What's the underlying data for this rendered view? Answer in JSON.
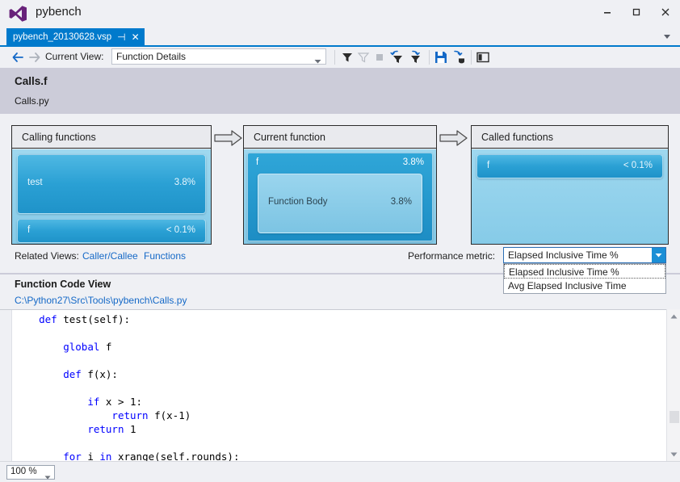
{
  "window": {
    "title": "pybench",
    "logo_icon": "visual-studio-logo",
    "minimize_label": "–",
    "maximize_label": "□",
    "close_label": "✕"
  },
  "tab": {
    "label": "pybench_20130628.vsp",
    "pin_icon": "pin-icon",
    "close_icon": "close-icon",
    "overflow_icon": "chevron-down-icon"
  },
  "toolbar": {
    "back_icon": "arrow-left-icon",
    "forward_icon": "arrow-right-icon",
    "current_view_label": "Current View:",
    "current_view_value": "Function Details",
    "icons": [
      "filter-icon",
      "clear-filter-icon",
      "stop-filter-icon",
      "undo-filter-icon",
      "redo-filter-icon",
      "save-icon",
      "export-report-icon",
      "split-view-icon"
    ]
  },
  "function_header": {
    "name": "Calls.f",
    "file": "Calls.py"
  },
  "panels": [
    {
      "id": "calling-functions",
      "title": "Calling functions",
      "bars": [
        {
          "label": "test",
          "value": "3.8%",
          "style": "strong"
        },
        {
          "label": "f",
          "value": "< 0.1%",
          "style": "strong"
        }
      ]
    },
    {
      "id": "current-function",
      "title": "Current function",
      "bars": [
        {
          "label": "f",
          "value": "3.8%",
          "style": "top"
        }
      ],
      "inner_bar": {
        "label": "Function Body",
        "value": "3.8%",
        "style": "light"
      }
    },
    {
      "id": "called-functions",
      "title": "Called functions",
      "bars": [
        {
          "label": "f",
          "value": "< 0.1%",
          "style": "strong"
        }
      ]
    }
  ],
  "arrows": {
    "icon": "arrow-right-3d-icon"
  },
  "related_views": {
    "label": "Related Views:",
    "links": [
      "Caller/Callee",
      "Functions"
    ]
  },
  "performance_metric": {
    "label": "Performance metric:",
    "selected": "Elapsed Inclusive Time %",
    "dropdown_icon": "chevron-down-icon",
    "options": [
      "Elapsed Inclusive Time %",
      "Avg Elapsed Inclusive Time"
    ]
  },
  "code_view": {
    "title": "Function Code View",
    "path": "C:\\Python27\\Src\\Tools\\pybench\\Calls.py",
    "lines": [
      [
        {
          "t": "    ",
          "c": "id"
        },
        {
          "t": "def",
          "c": "kw"
        },
        {
          "t": " test(self):",
          "c": "id"
        }
      ],
      [],
      [
        {
          "t": "        ",
          "c": "id"
        },
        {
          "t": "global",
          "c": "kw"
        },
        {
          "t": " f",
          "c": "id"
        }
      ],
      [],
      [
        {
          "t": "        ",
          "c": "id"
        },
        {
          "t": "def",
          "c": "kw"
        },
        {
          "t": " f(x):",
          "c": "id"
        }
      ],
      [],
      [
        {
          "t": "            ",
          "c": "id"
        },
        {
          "t": "if",
          "c": "kw"
        },
        {
          "t": " x > ",
          "c": "id"
        },
        {
          "t": "1",
          "c": "id"
        },
        {
          "t": ":",
          "c": "id"
        }
      ],
      [
        {
          "t": "                ",
          "c": "id"
        },
        {
          "t": "return",
          "c": "kw"
        },
        {
          "t": " f(x-1)",
          "c": "id"
        }
      ],
      [
        {
          "t": "            ",
          "c": "id"
        },
        {
          "t": "return",
          "c": "kw"
        },
        {
          "t": " 1",
          "c": "id"
        }
      ],
      [],
      [
        {
          "t": "        ",
          "c": "id"
        },
        {
          "t": "for",
          "c": "kw"
        },
        {
          "t": " i ",
          "c": "id"
        },
        {
          "t": "in",
          "c": "kw"
        },
        {
          "t": " xrange(self.rounds):",
          "c": "id"
        }
      ]
    ],
    "scrollbar": {
      "up_icon": "scroll-up-icon",
      "down_icon": "scroll-down-icon"
    }
  },
  "status": {
    "zoom_value": "100 %",
    "zoom_icon": "chevron-down-icon"
  },
  "colors": {
    "accent": "#007acc",
    "link": "#1569c7",
    "header_band": "#ccccd9",
    "panel_fill": "#86cbe8",
    "bar_strong": "#2aa0d4",
    "keyword": "#0000ff"
  }
}
